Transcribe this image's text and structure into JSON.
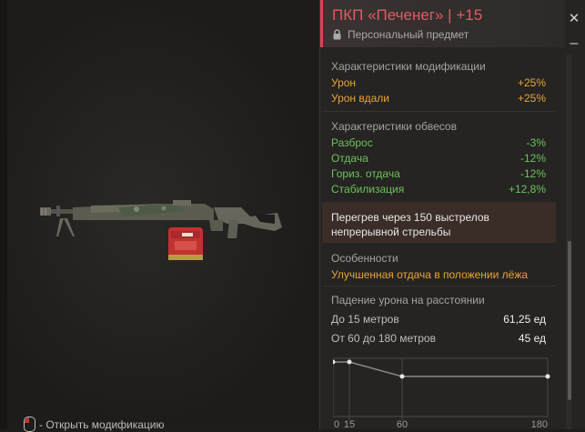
{
  "item": {
    "name": "ПКП «Печенег»",
    "upgrade": "+15",
    "personal_label": "Персональный предмет"
  },
  "mod_stats": {
    "title": "Характеристики модификации",
    "rows": [
      {
        "label": "Урон",
        "value": "+25%"
      },
      {
        "label": "Урон вдали",
        "value": "+25%"
      }
    ]
  },
  "attach_stats": {
    "title": "Характеристики обвесов",
    "rows": [
      {
        "label": "Разброс",
        "value": "-3%"
      },
      {
        "label": "Отдача",
        "value": "-12%"
      },
      {
        "label": "Гориз. отдача",
        "value": "-12%"
      },
      {
        "label": "Стабилизация",
        "value": "+12,8%"
      }
    ]
  },
  "overheat": {
    "text": "Перегрев через 150 выстрелов непрерывной стрельбы"
  },
  "features": {
    "title": "Особенности",
    "text": "Улучшенная отдача в положении лёжа"
  },
  "falloff": {
    "title": "Падение урона на расстоянии",
    "rows": [
      {
        "label": "До 15 метров",
        "value": "61,25 ед"
      },
      {
        "label": "От 60 до 180 метров",
        "value": "45 ед"
      }
    ],
    "chart_data": {
      "type": "line",
      "x": [
        0,
        15,
        60,
        180
      ],
      "y": [
        61.25,
        61.25,
        45,
        45
      ],
      "tick_labels": [
        "0",
        "15",
        "60",
        "180"
      ]
    }
  },
  "footer": {
    "hint": "- Открыть модификацию"
  },
  "colors": {
    "accent": "#e0405a",
    "positive_orange": "#e8a33b",
    "positive_green": "#6fc05f"
  }
}
